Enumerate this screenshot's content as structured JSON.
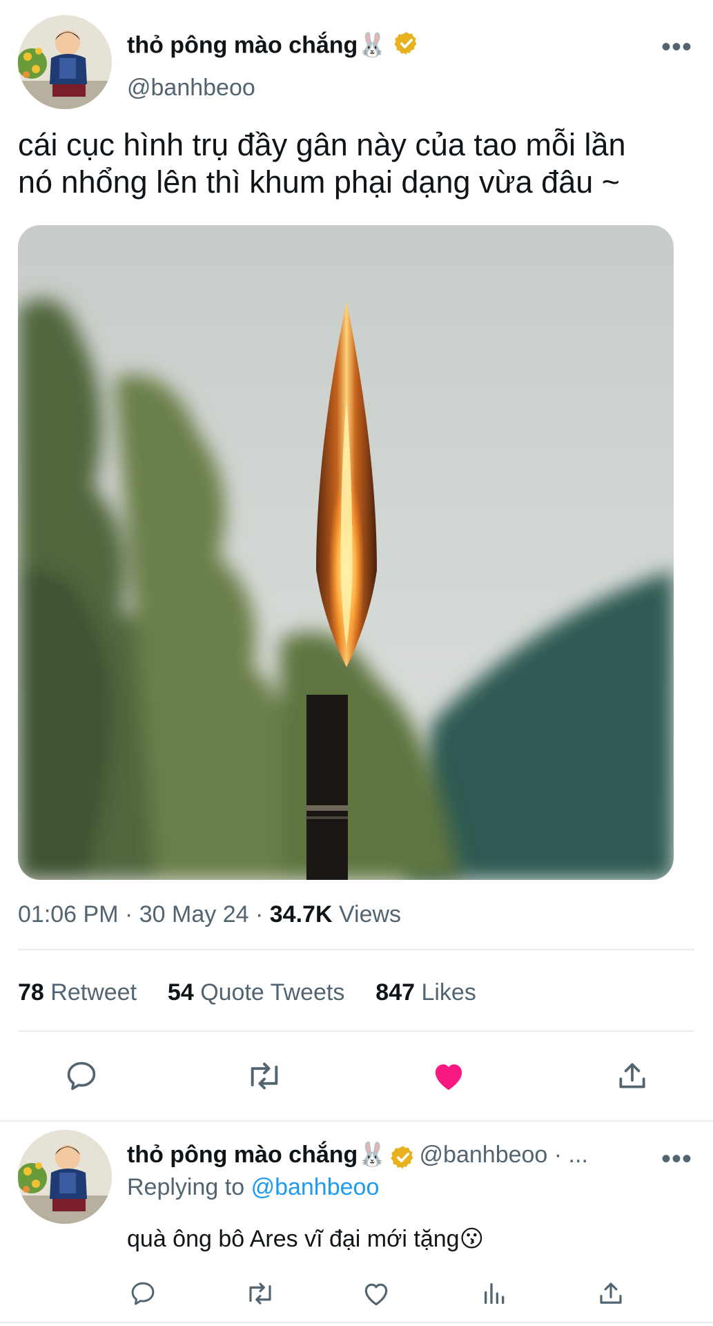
{
  "tweet": {
    "display_name": "thỏ pông mào chắng🐰",
    "handle": "@banhbeoo",
    "text_line1": "cái cục hình trụ đầy gân này của tao mỗi lần",
    "text_line2": "nó nhổng lên thì khum phại dạng vừa đâu ~",
    "time": "01:06 PM",
    "date": "30 May 24",
    "views_count": "34.7K",
    "views_label": "Views",
    "separator": "·",
    "more_label": "•••"
  },
  "stats": {
    "retweets_count": "78",
    "retweets_label": "Retweet",
    "quotes_count": "54",
    "quotes_label": "Quote Tweets",
    "likes_count": "847",
    "likes_label": "Likes"
  },
  "actions": {
    "reply_icon": "reply-icon",
    "retweet_icon": "retweet-icon",
    "like_icon": "heart-filled-icon",
    "share_icon": "share-icon",
    "like_color": "#f91880"
  },
  "reply": {
    "display_name": "thỏ pông mào chắng🐰",
    "handle_truncated": "@banhbeoo · ...",
    "replying_to_label": "Replying to",
    "replying_to_handle": "@banhbeoo",
    "text": "quà ông bô Ares vĩ đại mới tặng😗",
    "more_label": "•••"
  },
  "colors": {
    "verified_badge": "#e8b21f",
    "link": "#1d9bf0",
    "secondary_text": "#536471"
  }
}
